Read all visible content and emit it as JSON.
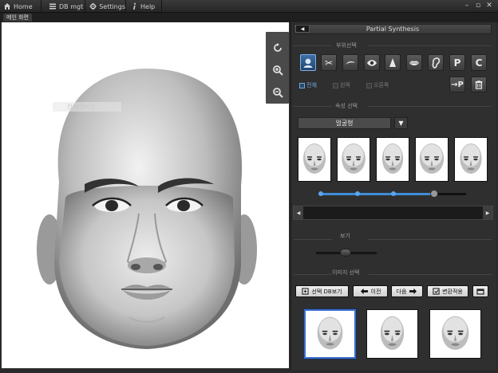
{
  "titlebar": {
    "nav": [
      {
        "label": "Home",
        "icon": "home-icon"
      },
      {
        "label": "DB mgt",
        "icon": "list-icon"
      },
      {
        "label": "Settings",
        "icon": "gear-icon"
      },
      {
        "label": "Help",
        "icon": "info-icon"
      }
    ],
    "window_controls": {
      "minimize": "–",
      "restore": "▫",
      "close": "✕"
    }
  },
  "subtab": {
    "label": "메인 화면"
  },
  "canvas": {
    "ghost_hint": "전 화면보기",
    "tools": [
      "rotate-icon",
      "zoom-in-icon",
      "zoom-out-icon"
    ]
  },
  "panel": {
    "header": "Partial Synthesis",
    "collapse_arrow": "◀",
    "part_section": "부위선택",
    "parts": [
      {
        "name": "face-part",
        "glyph": ""
      },
      {
        "name": "hair-part",
        "glyph": "✂"
      },
      {
        "name": "eyebrow-part",
        "glyph": ""
      },
      {
        "name": "eye-part",
        "glyph": ""
      },
      {
        "name": "nose-part",
        "glyph": ""
      },
      {
        "name": "lips-part",
        "glyph": ""
      },
      {
        "name": "ear-part",
        "glyph": ""
      },
      {
        "name": "p-part",
        "glyph": "P"
      },
      {
        "name": "c-part",
        "glyph": "C"
      }
    ],
    "checks": [
      {
        "label": "전체",
        "checked": true
      },
      {
        "label": "왼쪽",
        "checked": false
      },
      {
        "label": "오른쪽",
        "checked": false
      }
    ],
    "side_buttons": {
      "apply_p": "→P",
      "delete": "🗑"
    },
    "attr_section": "속성 선택",
    "attr_select": "얼굴형",
    "attr_arrow": "▼",
    "thumb_count": 5,
    "slider": {
      "value": 0.78,
      "ticks": [
        0.0,
        0.25,
        0.5,
        0.78
      ]
    },
    "view_section": "보기",
    "view_slider": {
      "value": 0.5
    },
    "image_section": "이미지 선택",
    "actions": [
      {
        "label": "선택 DB보기",
        "icon": "db-view-icon"
      },
      {
        "label": "이전",
        "icon": "arrow-left-icon"
      },
      {
        "label": "다음",
        "icon": "arrow-right-icon"
      },
      {
        "label": "변환적용",
        "icon": "apply-icon"
      },
      {
        "label": "",
        "icon": "window-icon"
      }
    ]
  },
  "colors": {
    "accent": "#3f8ed8",
    "panel_bg": "#2f2f2f",
    "canvas_bg": "#ffffff"
  }
}
